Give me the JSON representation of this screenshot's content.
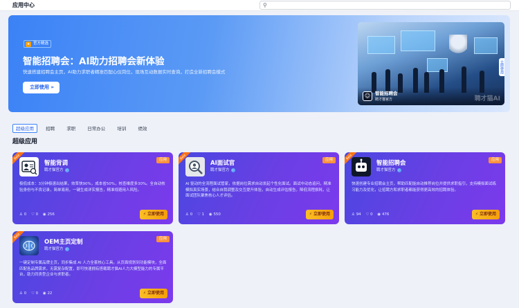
{
  "header": {
    "title": "应用中心",
    "search_placeholder": ""
  },
  "banner": {
    "badge": "官方精选",
    "title": "智能招聘会：AI助力招聘会新体验",
    "subtitle": "快速搭建招聘会主页，AI助力求职者精准匹配心仪岗位，现场互动数据实时查询，打造全新招聘会模式",
    "button": "立即使用 »",
    "image": {
      "title": "智能招聘会",
      "author": "聘才猫官方",
      "watermark": "聘才猫AI",
      "side_tab": "立即使用"
    }
  },
  "tabs": [
    {
      "label": "超级应用",
      "active": true
    },
    {
      "label": "招聘"
    },
    {
      "label": "求职"
    },
    {
      "label": "日常办公"
    },
    {
      "label": "培训"
    },
    {
      "label": "绩效"
    }
  ],
  "section_title": "超级应用",
  "cards": [
    {
      "ribbon": "Beta",
      "tag": "应用",
      "name": "智能背调",
      "author": "聘才猫官方",
      "desc": "极低成本：3分钟极速出结果，效率快90%，成本省50%，核查维度多30%。全自动核验身份与不良记录，简单易用，一键生成详实报告，精准规避用人风险。",
      "stats": [
        "0",
        "0",
        "256"
      ],
      "button": "⚡ 立即使用"
    },
    {
      "ribbon": "Beta",
      "tag": "应用",
      "name": "AI面试官",
      "author": "聘才猫官方",
      "desc": "AI 驱动的全流程面试管家，依据岗位需求自动发起个性化面试。面试中动态追问，精准模拟真实场景，结合自我调整及交互提升体验，自动生成评估报告，降低流程损耗，让面试团队聚焦核心人才评估。",
      "stats": [
        "0",
        "1",
        "550"
      ],
      "button": "⚡ 立即使用"
    },
    {
      "ribbon": "Beta",
      "tag": "应用",
      "name": "智能招聘会",
      "author": "聘才猫官方",
      "desc": "快速创建专业招聘会主页，帮助匹配能自动推荐岗位并提供求职指引，支持模拟面试练习能力及优化，让招聘方和求职者都能获得更高效的招聘体验。",
      "stats": [
        "94",
        "0",
        "476"
      ],
      "button": "⚡ 立即使用"
    },
    {
      "ribbon": "Beta",
      "tag": "应用",
      "name": "OEM主页定制",
      "author": "聘才猫官方",
      "desc": "一键定制专属品牌主页，同步集成 AI 人力全套核心工具。从页面规划到功能模块，全面匹配各品牌需求，无需复杂配置，即可快速拥有搭载聘才猫AI人力大模型能力的专属平台，助力同类型企业与求职者。",
      "stats": [
        "0",
        "0",
        "22"
      ],
      "button": "⚡ 立即使用"
    }
  ],
  "stat_icons": [
    "user-icon",
    "thumbs-up-icon",
    "eye-icon"
  ],
  "colors": {
    "accent": "#3b82f6",
    "card_gradient_start": "#4a47e0",
    "card_gradient_end": "#7c3aed",
    "button": "#f59e0b",
    "tag": "#fb923c"
  }
}
